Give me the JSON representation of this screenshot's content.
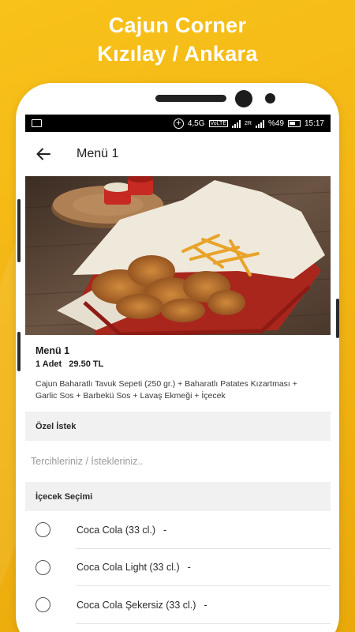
{
  "promo": {
    "line1": "Cajun Corner",
    "line2": "Kızılay / Ankara"
  },
  "status_bar": {
    "network": "4,5G",
    "volte": "VoLTE",
    "data": "2R",
    "battery": "%49",
    "time": "15:17"
  },
  "toolbar": {
    "title": "Menü 1",
    "back_icon": "arrow-left-icon"
  },
  "item": {
    "name": "Menü 1",
    "quantity": "1 Adet",
    "price": "29.50 TL",
    "description": "Cajun Baharatlı Tavuk Sepeti (250 gr.) + Baharatlı Patates Kızartması + Garlic Sos + Barbekü Sos + Lavaş Ekmeği + İçecek"
  },
  "special_request": {
    "title": "Özel İstek",
    "placeholder": "Tercihleriniz / İstekleriniz.."
  },
  "drink_selection": {
    "title": "İçecek Seçimi",
    "options": [
      {
        "label": "Coca Cola (33 cl.)",
        "price": "-"
      },
      {
        "label": "Coca Cola Light (33 cl.)",
        "price": "-"
      },
      {
        "label": "Coca Cola Şekersiz (33 cl.)",
        "price": "-"
      }
    ]
  },
  "colors": {
    "background": "#f3b514",
    "phone": "#ffffff",
    "status_bar": "#000000",
    "section_bg": "#f1f1f1"
  }
}
